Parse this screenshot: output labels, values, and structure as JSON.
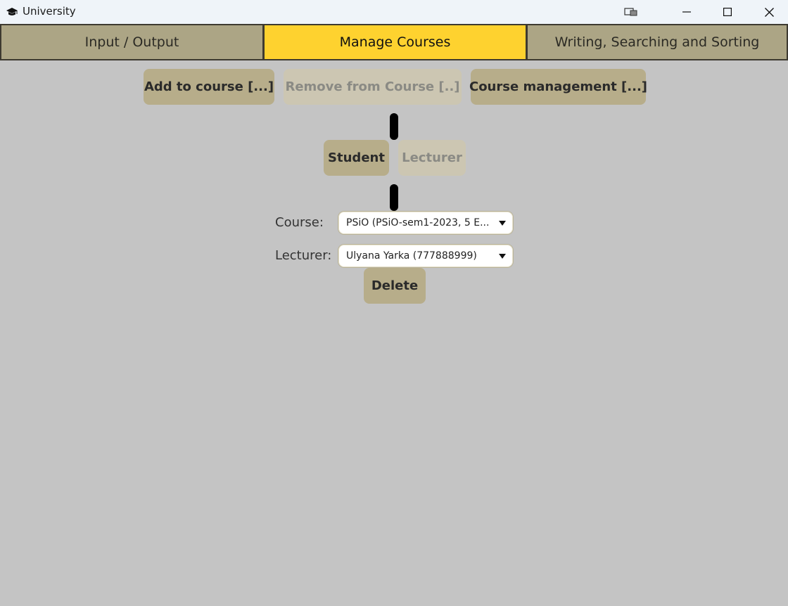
{
  "window": {
    "title": "University",
    "app_icon": "graduation-cap-icon",
    "controls": [
      "snap-layout-icon",
      "minimize-icon",
      "maximize-icon",
      "close-icon"
    ]
  },
  "tabs": [
    {
      "label": "Input / Output",
      "active": false
    },
    {
      "label": "Manage Courses",
      "active": true
    },
    {
      "label": "Writing, Searching and Sorting",
      "active": false
    }
  ],
  "actions": {
    "add_to_course": "Add to course [...]",
    "remove_from_course": "Remove from Course  [..]",
    "course_management": "Course management [...]"
  },
  "roles": {
    "student": "Student",
    "lecturer": "Lecturer"
  },
  "form": {
    "course_label": "Course:",
    "course_value": "PSiO (PSiO-sem1-2023, 5 E...",
    "lecturer_label": "Lecturer:",
    "lecturer_value": "Ulyana Yarka (777888999)",
    "delete_label": "Delete"
  },
  "colors": {
    "background": "#c4c4c4",
    "tab": "#aca585",
    "tab_active": "#fed22f",
    "button": "#b7ad8a",
    "button_disabled": "#ccc6b2"
  }
}
